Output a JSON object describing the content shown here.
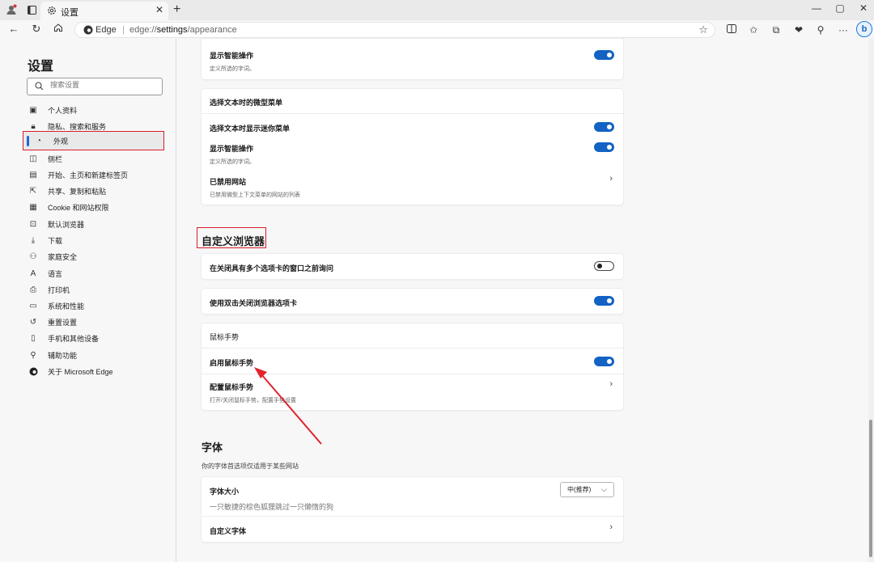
{
  "browser": {
    "tab_title": "设置",
    "site_name": "Edge",
    "url_prefix": "edge://",
    "url_bold": "settings",
    "url_suffix": "/appearance",
    "icons": [
      "profile-icon",
      "tab-actions-icon",
      "settings-gear-icon",
      "close-icon",
      "new-tab-icon",
      "minimize-icon",
      "maximize-icon",
      "window-close-icon",
      "back-icon",
      "refresh-icon",
      "home-icon",
      "favorite-star-icon",
      "split-screen-icon",
      "favorites-icon",
      "collections-icon",
      "browser-essentials-icon",
      "extensions-icon",
      "more-icon",
      "copilot-icon"
    ]
  },
  "sidebar": {
    "title": "设置",
    "search_placeholder": "搜索设置",
    "items": [
      {
        "label": "个人资料",
        "icon": "profile-card-icon"
      },
      {
        "label": "隐私、搜索和服务",
        "icon": "lock-icon"
      },
      {
        "label": "外观",
        "icon": "appearance-icon",
        "active": true
      },
      {
        "label": "侧栏",
        "icon": "sidebar-icon"
      },
      {
        "label": "开始、主页和新建标签页",
        "icon": "home-page-icon"
      },
      {
        "label": "共享、复制和粘贴",
        "icon": "share-icon"
      },
      {
        "label": "Cookie 和网站权限",
        "icon": "cookie-icon"
      },
      {
        "label": "默认浏览器",
        "icon": "default-browser-icon"
      },
      {
        "label": "下载",
        "icon": "download-icon"
      },
      {
        "label": "家庭安全",
        "icon": "family-icon"
      },
      {
        "label": "语言",
        "icon": "language-icon"
      },
      {
        "label": "打印机",
        "icon": "printer-icon"
      },
      {
        "label": "系统和性能",
        "icon": "laptop-icon"
      },
      {
        "label": "重置设置",
        "icon": "reset-icon"
      },
      {
        "label": "手机和其他设备",
        "icon": "phone-icon"
      },
      {
        "label": "辅助功能",
        "icon": "accessibility-icon"
      },
      {
        "label": "关于 Microsoft Edge",
        "icon": "edge-logo-icon"
      }
    ]
  },
  "content": {
    "card_smart_actions": {
      "title": "显示智能操作",
      "sub": "定义所选的字词。",
      "enabled": true
    },
    "card_mini_menu": {
      "header": "选择文本时的微型菜单",
      "row1_title": "选择文本时显示迷你菜单",
      "row1_enabled": true,
      "row2_title": "显示智能操作",
      "row2_sub": "定义所选的字词。",
      "row2_enabled": true,
      "row3_title": "已禁用网站",
      "row3_sub": "已禁用微型上下文菜单的网站的列表"
    },
    "customize_heading": "自定义浏览器",
    "ask_before_close": {
      "title": "在关闭具有多个选项卡的窗口之前询问",
      "enabled": false
    },
    "double_click_close": {
      "title": "使用双击关闭浏览器选项卡",
      "enabled": true
    },
    "mouse_gesture": {
      "header": "鼠标手势",
      "enable_title": "启用鼠标手势",
      "enabled": true,
      "config_title": "配置鼠标手势",
      "config_sub": "打开/关闭鼠标手势，配置手势设置"
    },
    "fonts": {
      "heading": "字体",
      "desc": "你的字体首选项仅适用于某些网站",
      "size_title": "字体大小",
      "size_sample": "一只敏捷的棕色狐狸跳过一只懒惰的狗",
      "size_value": "中(推荐)",
      "custom_title": "自定义字体"
    },
    "annotation_color": "#d81e2a",
    "accent_color": "#1362c4"
  }
}
